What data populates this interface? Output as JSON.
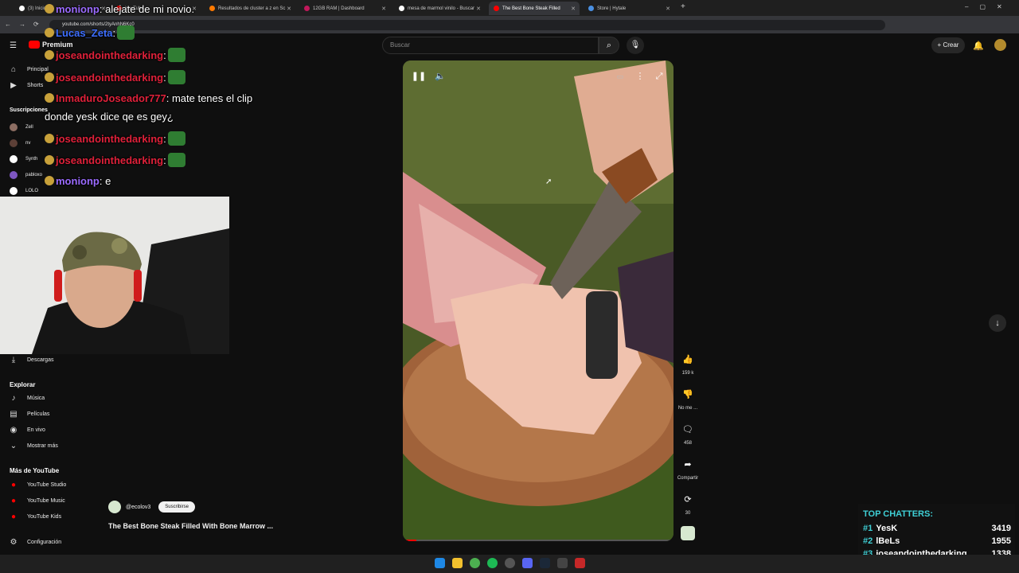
{
  "browser": {
    "tabs": [
      {
        "label": "(3) Inicio / X",
        "active": false,
        "color": "#ffffff"
      },
      {
        "label": "YouTube",
        "active": false,
        "color": "#ff0000"
      },
      {
        "label": "Resultados de cluster a z en Sc",
        "active": false,
        "color": "#ff7a00"
      },
      {
        "label": "12GB RAM | Dashboard",
        "active": false,
        "color": "#c2185b"
      },
      {
        "label": "mesa de marmol vinilo - Buscar",
        "active": false,
        "color": "#ffffff"
      },
      {
        "label": "The Best Bone Steak Filled",
        "active": true,
        "color": "#ff0000"
      },
      {
        "label": "Store | Hytale",
        "active": false,
        "color": "#4a90e2"
      }
    ],
    "url": "youtube.com/shorts/2tyAnhN6Kc0"
  },
  "header": {
    "logo": "Premium",
    "search_placeholder": "Buscar",
    "create_label": "Crear"
  },
  "sidebar": {
    "top": [
      {
        "label": "Principal",
        "icon": "home-icon"
      },
      {
        "label": "Shorts",
        "icon": "shorts-icon"
      }
    ],
    "subs_header": "Suscripciones",
    "channels": [
      {
        "label": "Zell",
        "color": "#8d6e63"
      },
      {
        "label": "nv",
        "color": "#5d4037"
      },
      {
        "label": "Synth",
        "color": "#ffffff"
      },
      {
        "label": "pabloxo",
        "color": "#7e57c2"
      },
      {
        "label": "LOLO",
        "color": "#ffffff"
      }
    ],
    "downloads": "Descargas",
    "explore_header": "Explorar",
    "explore": [
      {
        "label": "Música",
        "icon": "music-icon"
      },
      {
        "label": "Películas",
        "icon": "film-icon"
      },
      {
        "label": "En vivo",
        "icon": "live-icon"
      },
      {
        "label": "Mostrar más",
        "icon": "chevron-down-icon"
      }
    ],
    "more_header": "Más de YouTube",
    "more": [
      {
        "label": "YouTube Studio"
      },
      {
        "label": "YouTube Music"
      },
      {
        "label": "YouTube Kids"
      }
    ],
    "settings": "Configuración"
  },
  "chat": [
    {
      "user": "monionp",
      "user_color": "#9b6bff",
      "msg": ": alejate de mi novio."
    },
    {
      "user": "Lucas_Zeta",
      "user_color": "#3d6eff",
      "msg": ":"
    },
    {
      "user": "joseandointhedarking",
      "user_color": "#e0213a",
      "msg": ":"
    },
    {
      "user": "joseandointhedarking",
      "user_color": "#e0213a",
      "msg": ":"
    },
    {
      "user": "InmaduroJoseador777",
      "user_color": "#e0213a",
      "msg": ": mate tenes el clip"
    },
    {
      "user": "",
      "user_color": "#ffffff",
      "msg": "donde yesk dice qe es gey¿"
    },
    {
      "user": "joseandointhedarking",
      "user_color": "#e0213a",
      "msg": ":"
    },
    {
      "user": "joseandointhedarking",
      "user_color": "#e0213a",
      "msg": ":"
    },
    {
      "user": "monionp",
      "user_color": "#9b6bff",
      "msg": ": e"
    }
  ],
  "short": {
    "channel": "@ecolov3",
    "subscribe": "Suscribirse",
    "title": "The Best Bone Steak Filled With Bone Marrow  ...",
    "likes": "159 k",
    "dislike": "No me ...",
    "comments": "458",
    "share": "Compartir",
    "remix": "30",
    "progress": 0.05
  },
  "top_chatters": {
    "title": "TOP CHATTERS:",
    "rows": [
      {
        "rank": "#1",
        "name": "YesK",
        "count": "3419"
      },
      {
        "rank": "#2",
        "name": "lBeLs",
        "count": "1955"
      },
      {
        "rank": "#3",
        "name": "joseandointhedarking",
        "count": "1338"
      }
    ]
  }
}
